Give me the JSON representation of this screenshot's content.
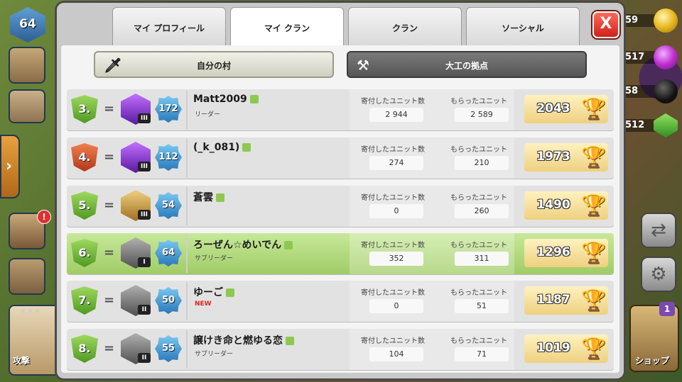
{
  "tabs": [
    "マイ プロフィール",
    "マイ クラン",
    "クラン",
    "ソーシャル"
  ],
  "active_tab": 1,
  "close_label": "X",
  "subtabs": {
    "home": "自分の村",
    "builder": "大工の拠点"
  },
  "stat_labels": {
    "donated": "寄付したユニット数",
    "received": "もらったユニット"
  },
  "hud": {
    "player_level": "64",
    "expand_arrow": "›",
    "war_alert": "!",
    "attack_label": "攻撃",
    "shop_label": "ショップ",
    "shop_badge": "1",
    "resources": {
      "gold": "59",
      "elixir": "517",
      "dark_elixir": "58",
      "gems": "512"
    }
  },
  "members": [
    {
      "rank": "3.",
      "change": "=",
      "league_tier": "III",
      "league": "crystal",
      "xp_level": "172",
      "name": "Matt2009",
      "role": "リーダー",
      "donated": "2 944",
      "received": "2 589",
      "trophies": "2043",
      "rank_color": "green",
      "highlight": false
    },
    {
      "rank": "4.",
      "change": "=",
      "league_tier": "III",
      "league": "crystal",
      "xp_level": "112",
      "name": "(_k_081)",
      "role": "",
      "donated": "274",
      "received": "210",
      "trophies": "1973",
      "rank_color": "red",
      "highlight": false
    },
    {
      "rank": "5.",
      "change": "=",
      "league_tier": "III",
      "league": "gold",
      "xp_level": "54",
      "name": "蒼雲",
      "role": "",
      "donated": "0",
      "received": "260",
      "trophies": "1490",
      "rank_color": "green",
      "highlight": false
    },
    {
      "rank": "6.",
      "change": "=",
      "league_tier": "I",
      "league": "silver",
      "xp_level": "64",
      "name": "ろーぜん☆めいでん",
      "role": "サブリーダー",
      "donated": "352",
      "received": "311",
      "trophies": "1296",
      "rank_color": "green",
      "highlight": true
    },
    {
      "rank": "7.",
      "change": "=",
      "league_tier": "II",
      "league": "silver",
      "xp_level": "50",
      "name": "ゆーご",
      "role": "NEW",
      "donated": "0",
      "received": "51",
      "trophies": "1187",
      "rank_color": "green",
      "highlight": false
    },
    {
      "rank": "8.",
      "change": "=",
      "league_tier": "II",
      "league": "silver",
      "xp_level": "55",
      "name": "譲けき命と燃ゆる恋",
      "role": "サブリーダー",
      "donated": "104",
      "received": "71",
      "trophies": "1019",
      "rank_color": "green",
      "highlight": false
    }
  ],
  "icons": {
    "trophy": "trophy-icon",
    "note": "note-icon",
    "sword": "sword-icon",
    "hammer": "hammer-icon"
  }
}
